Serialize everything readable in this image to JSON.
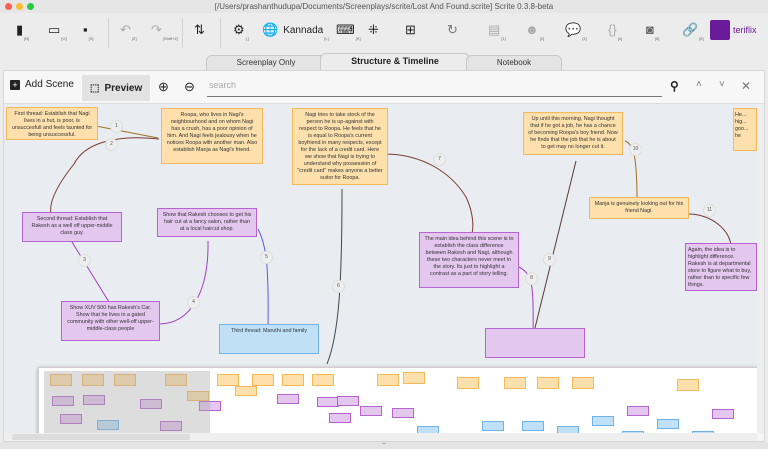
{
  "window": {
    "title": "[/Users/prashanthudupa/Documents/Screenplays/scrite/Lost And Found.scrite] Scrite 0.3.8-beta"
  },
  "toolbar": {
    "new": {
      "icon": "new-file-icon",
      "shortcut": "[N]"
    },
    "open": {
      "icon": "folder-icon",
      "shortcut": "[O]"
    },
    "save": {
      "icon": "save-icon",
      "shortcut": "[S]"
    },
    "undo": {
      "icon": "undo-icon",
      "shortcut": "[Z]"
    },
    "redo": {
      "icon": "redo-icon",
      "shortcut": "[Shift+Z]"
    },
    "sort": {
      "icon": "sort-icon"
    },
    "settings": {
      "icon": "gear-icon",
      "shortcut": "[,]"
    },
    "language": {
      "label": "Kannada",
      "shortcut": "[L]"
    },
    "keyboard": {
      "icon": "keyboard-icon",
      "shortcut": "[K]"
    },
    "collapse": {
      "icon": "collapse-icon"
    },
    "add": {
      "icon": "add-icon"
    },
    "reload": {
      "icon": "reload-icon"
    },
    "scene": {
      "shortcut": "[1]"
    },
    "character": {
      "shortcut": "[2]"
    },
    "dialogue": {
      "shortcut": "[3]"
    },
    "parens": {
      "shortcut": "[4]"
    },
    "shot": {
      "shortcut": "[5]"
    },
    "link": {
      "shortcut": "[6]"
    },
    "brand": "teriflix"
  },
  "tabs": [
    "Screenplay Only",
    "Structure & Timeline",
    "Notebook"
  ],
  "searchbar": {
    "add_scene": "Add Scene",
    "preview": "Preview",
    "search_placeholder": "search"
  },
  "notes": [
    "First thread: Establish that Nagi lives in a hut, is poor, is unsuccesfull and feels taunted for being unsuccessful.",
    "Roopa, who lives in Nagi's neighbourhood and on whom Nagi has a crush, has a poor opinion of him. And Nagi feels jealousy when he notices Roopa with another man. Also establish Manja as Nagi's friend.",
    "Nagi tries to take stock of the person he is up-against with respect to Roopa. He feels that he is equal to Roopa's current boyfriend in many respects, except for the lack of a credit card.  Here we show that Nagi is trying to understand why possession of \"credit card\" makes anyone a better suitor for Roopa.",
    "Second thread: Establish that Rakesh as a well off upper-middle class guy.",
    "Show that Rakesh chooses to get his hair cut at a fancy salon, rather than at a local haircut shop.",
    "Show XUV 500 has Rakesh's Car. Show that he lives in a gated community with other well-off upper-middle-class people",
    "Third thread: Maruthi and family",
    "The main idea behind this scene is to establish the class difference between Rakesh and Nagi, although these two characters never meet in the story. Its just to highlight a contrast as a part of story telling.",
    "Up until this morning, Nagi thought that if he got a job, he has a chance of becoming Roopa's boy friend. Now he finds that the job that he is about to get may no longer cut it.",
    "Manja is genuinely looking out for his friend Nagi.",
    "Again, the idea is to highlight difference. Rakesh is at departmental store to figure what to buy, rather than to specific few things.",
    "He... hig... goo... he"
  ],
  "connectors": [
    "1",
    "2",
    "3",
    "4",
    "5",
    "6",
    "7",
    "8",
    "9",
    "10",
    "11"
  ],
  "colors": {
    "orange": "#fde0ac",
    "purple": "#e3c7ef",
    "blue": "#bfe0f7"
  }
}
